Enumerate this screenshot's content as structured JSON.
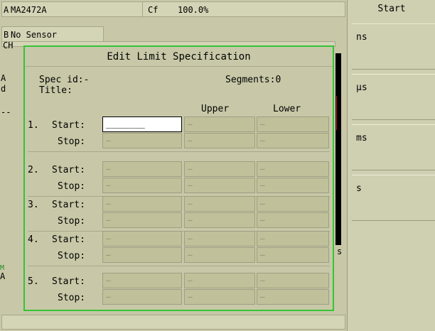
{
  "screen": {
    "channel_a": {
      "letter": "A",
      "model": "MA2472A",
      "cf_label": "Cf",
      "cf_value": "100.0%"
    },
    "channel_b": {
      "letter": "B",
      "status": "No Sensor"
    },
    "ch_row_partial": "CH",
    "left_letters": [
      "A",
      "d"
    ],
    "dash": "--",
    "bottom_letters": [
      "M",
      "A"
    ],
    "trace_right_letter": "s"
  },
  "softkeys": {
    "title": "Start",
    "items": [
      "ns",
      "µs",
      "ms",
      "s"
    ]
  },
  "dialog": {
    "title": "Edit Limit Specification",
    "spec_id_label": "Spec id:-",
    "segments_label": "Segments:0",
    "title_label": "Title:",
    "col_upper": "Upper",
    "col_lower": "Lower",
    "start_label": "Start:",
    "stop_label": "Stop:",
    "rows": [
      {
        "num": "1.",
        "start_value": "_______",
        "placeholder": "—"
      },
      {
        "num": "2.",
        "placeholder": "—"
      },
      {
        "num": "3.",
        "placeholder": "—"
      },
      {
        "num": "4.",
        "placeholder": "—"
      },
      {
        "num": "5.",
        "placeholder": "—"
      }
    ]
  },
  "colors": {
    "dialog_border": "#35c435",
    "trace": "#cc2020"
  }
}
